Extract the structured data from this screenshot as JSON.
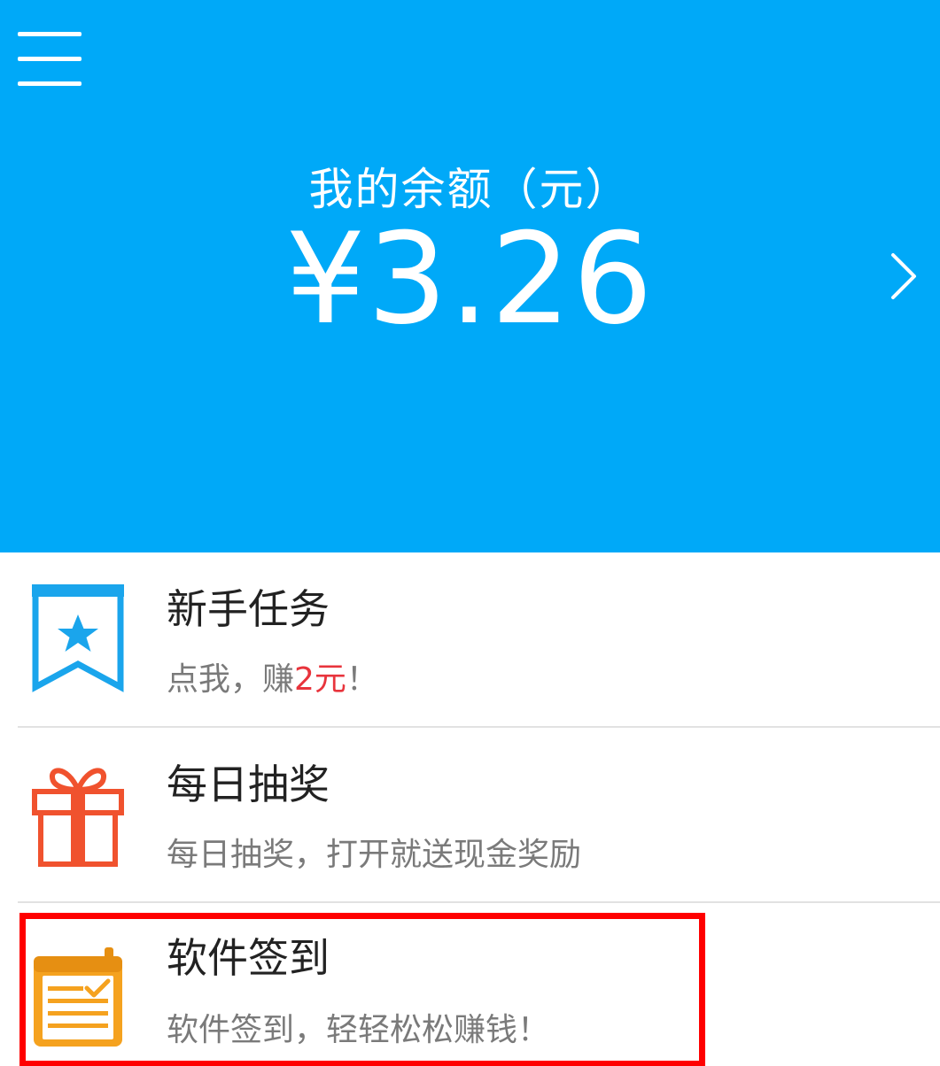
{
  "header": {
    "balance_label": "我的余额（元）",
    "balance_value": "¥3.26",
    "background_color": "#00a9f8"
  },
  "icons": {
    "menu": "hamburger-menu-icon",
    "chevron": "chevron-right-icon"
  },
  "tasks": [
    {
      "title": "新手任务",
      "subtitle_parts": [
        "点我，赚",
        "2元",
        "！"
      ],
      "icon": "bookmark-star-icon",
      "icon_color": "#1aa5ec"
    },
    {
      "title": "每日抽奖",
      "subtitle": "每日抽奖，打开就送现金奖励",
      "icon": "gift-icon",
      "icon_color": "#f0522e"
    },
    {
      "title": "软件签到",
      "subtitle": "软件签到，轻轻松松赚钱！",
      "icon": "calendar-check-icon",
      "icon_color": "#f5a21f"
    }
  ],
  "colors": {
    "highlight_border": "#ff0000",
    "reward_text": "#e8343c"
  }
}
